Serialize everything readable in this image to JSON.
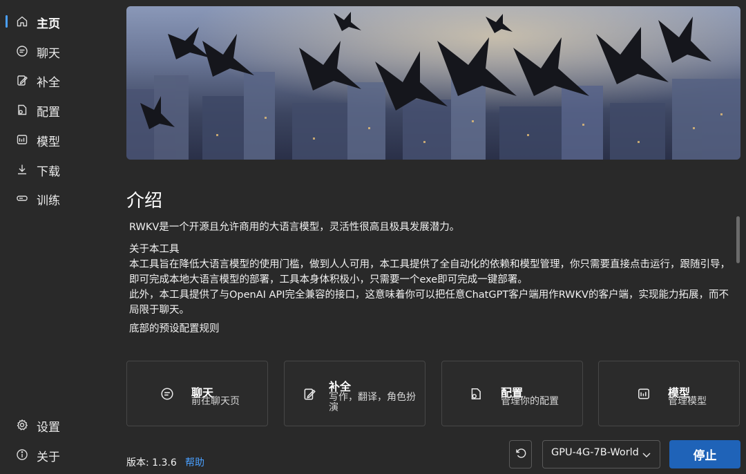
{
  "sidebar": {
    "items": [
      {
        "label": "主页",
        "icon": "home-icon"
      },
      {
        "label": "聊天",
        "icon": "chat-icon"
      },
      {
        "label": "补全",
        "icon": "edit-icon"
      },
      {
        "label": "配置",
        "icon": "config-icon"
      },
      {
        "label": "模型",
        "icon": "model-icon"
      },
      {
        "label": "下载",
        "icon": "download-icon"
      },
      {
        "label": "训练",
        "icon": "train-icon"
      }
    ],
    "bottom": [
      {
        "label": "设置",
        "icon": "settings-icon"
      },
      {
        "label": "关于",
        "icon": "info-icon"
      }
    ]
  },
  "intro": {
    "title": "介绍",
    "p1": "RWKV是一个开源且允许商用的大语言模型，灵活性很高且极具发展潜力。",
    "p2_title": "关于本工具",
    "p2_line1": "本工具旨在降低大语言模型的使用门槛，做到人人可用，本工具提供了全自动化的依赖和模型管理，你只需要直接点击运行，跟随引导，即可完成本地大语言模型的部署，工具本身体积极小，只需要一个exe即可完成一键部署。",
    "p2_line2": "此外，本工具提供了与OpenAI API完全兼容的接口，这意味着你可以把任意ChatGPT客户端用作RWKV的客户端，实现能力拓展，而不局限于聊天。",
    "p3": "底部的预设配置规则"
  },
  "cards": [
    {
      "title": "聊天",
      "desc": "前往聊天页"
    },
    {
      "title": "补全",
      "desc": "写作，翻译，角色扮演"
    },
    {
      "title": "配置",
      "desc": "管理你的配置"
    },
    {
      "title": "模型",
      "desc": "管理模型"
    }
  ],
  "footer": {
    "version": "版本: 1.3.6",
    "help": "帮助",
    "preset": "GPU-4G-7B-World",
    "stop": "停止"
  },
  "colors": {
    "background": "#292929",
    "accent": "#4aa0ff",
    "primary_button": "#1f63b8"
  }
}
